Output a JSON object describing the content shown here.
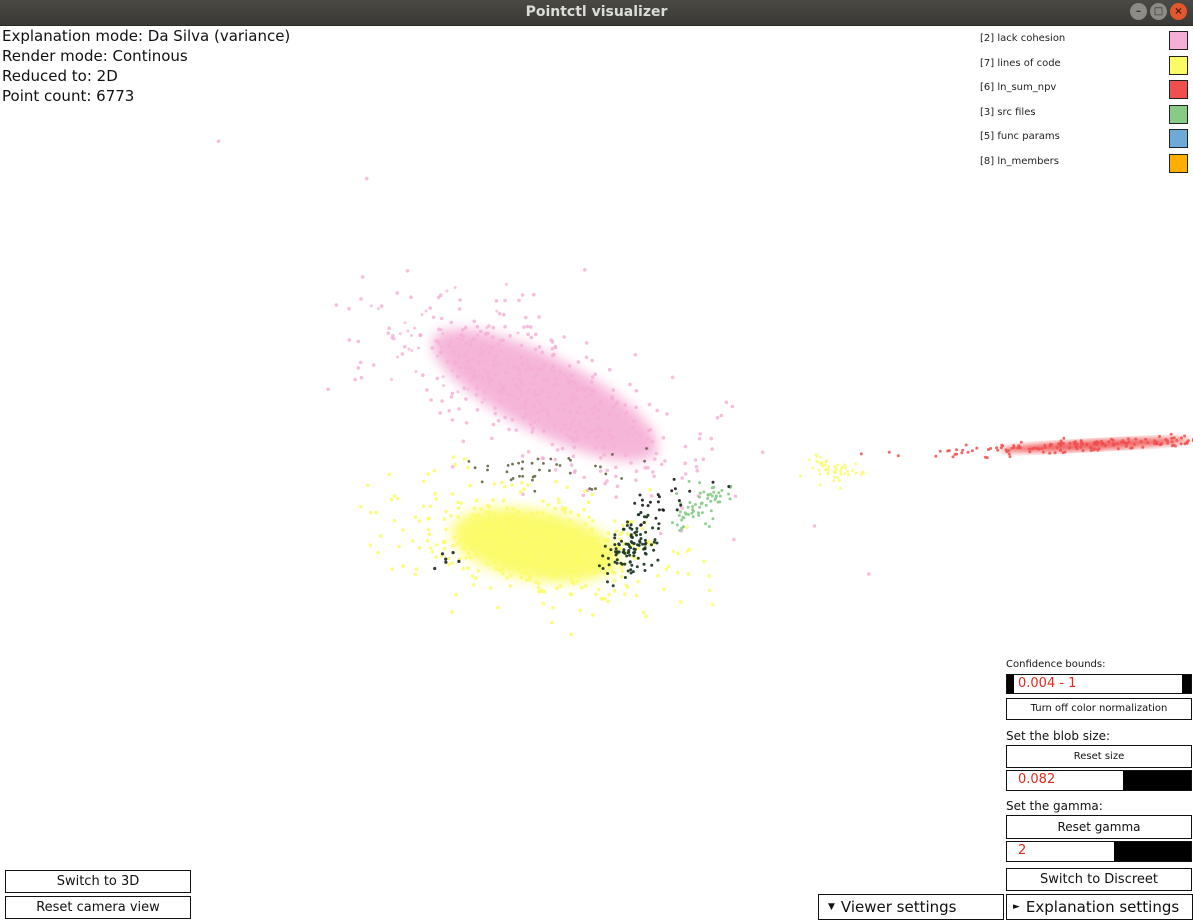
{
  "window": {
    "title": "Pointctl visualizer",
    "controls": [
      "minimize-icon",
      "maximize-icon",
      "close-icon"
    ]
  },
  "info": {
    "explanation_mode": "Explanation mode: Da Silva (variance)",
    "render_mode": "Render mode: Continous",
    "reduced_to": "Reduced to: 2D",
    "point_count": "Point count: 6773"
  },
  "legend": [
    {
      "label": "[2] lack cohesion",
      "color": "#f5aed5"
    },
    {
      "label": "[7] lines of code",
      "color": "#fbfb66"
    },
    {
      "label": "[6] ln_sum_npv",
      "color": "#ef4f4f"
    },
    {
      "label": "[3] src files",
      "color": "#86cb86"
    },
    {
      "label": "[5] func params",
      "color": "#6eaad8"
    },
    {
      "label": "[8] ln_members",
      "color": "#fdae00"
    }
  ],
  "controls": {
    "confidence_label": "Confidence bounds:",
    "confidence_value": "0.004 - 1",
    "color_norm_button": "Turn off color normalization",
    "blob_label": "Set the blob size:",
    "reset_size_button": "Reset size",
    "blob_value": "0.082",
    "blob_fraction": 0.37,
    "gamma_label": "Set the gamma:",
    "reset_gamma_button": "Reset gamma",
    "gamma_value": "2",
    "gamma_fraction": 0.42,
    "switch_discreet_button": "Switch to Discreet",
    "switch_3d_button": "Switch to 3D",
    "reset_camera_button": "Reset camera view",
    "viewer_settings_tab": "Viewer settings",
    "explanation_settings_tab": "Explanation settings"
  }
}
